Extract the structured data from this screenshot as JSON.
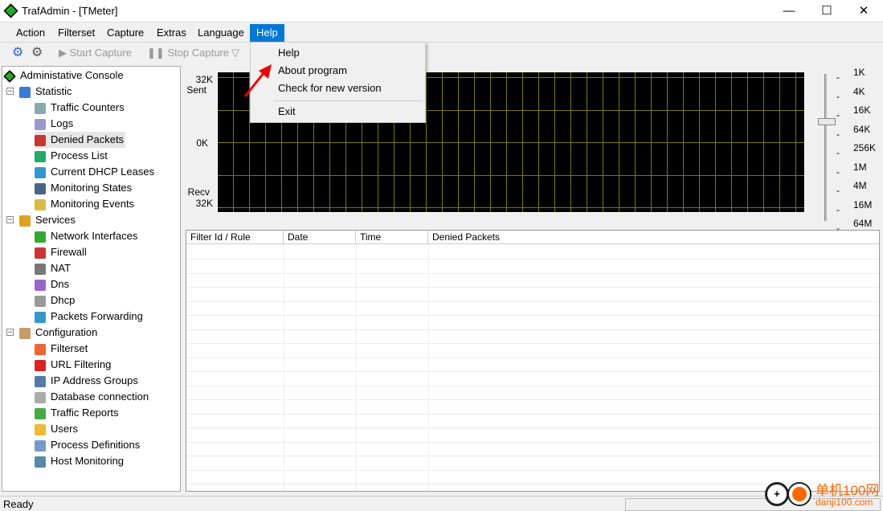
{
  "window": {
    "title": "TrafAdmin - [TMeter]",
    "minimize": "—",
    "maximize": "☐",
    "close": "✕"
  },
  "menu": [
    "Action",
    "Filterset",
    "Capture",
    "Extras",
    "Language",
    "Help"
  ],
  "toolbar": {
    "start_capture": "Start Capture",
    "stop_capture": "Stop Capture"
  },
  "help_menu": {
    "items": [
      "Help",
      "About program",
      "Check for new version"
    ],
    "exit": "Exit"
  },
  "tree": {
    "root": "Administative Console",
    "groups": [
      {
        "label": "Statistic",
        "color": "#3a7bd5",
        "items": [
          {
            "label": "Traffic Counters",
            "color": "#8aa"
          },
          {
            "label": "Logs",
            "color": "#99c"
          },
          {
            "label": "Denied Packets",
            "color": "#c33"
          },
          {
            "label": "Process List",
            "color": "#2a6"
          },
          {
            "label": "Current DHCP Leases",
            "color": "#39c"
          },
          {
            "label": "Monitoring States",
            "color": "#468"
          },
          {
            "label": "Monitoring Events",
            "color": "#db4"
          }
        ]
      },
      {
        "label": "Services",
        "color": "#e0a020",
        "items": [
          {
            "label": "Network Interfaces",
            "color": "#3a3"
          },
          {
            "label": "Firewall",
            "color": "#c33"
          },
          {
            "label": "NAT",
            "color": "#777"
          },
          {
            "label": "Dns",
            "color": "#96c"
          },
          {
            "label": "Dhcp",
            "color": "#999"
          },
          {
            "label": "Packets Forwarding",
            "color": "#39c"
          }
        ]
      },
      {
        "label": "Configuration",
        "color": "#c96",
        "items": [
          {
            "label": "Filterset",
            "color": "#e63"
          },
          {
            "label": "URL Filtering",
            "color": "#d22"
          },
          {
            "label": "IP Address Groups",
            "color": "#57a"
          },
          {
            "label": "Database connection",
            "color": "#aaa"
          },
          {
            "label": "Traffic Reports",
            "color": "#4a4"
          },
          {
            "label": "Users",
            "color": "#eb3"
          },
          {
            "label": "Process Definitions",
            "color": "#79c"
          },
          {
            "label": "Host Monitoring",
            "color": "#58a"
          }
        ]
      }
    ]
  },
  "graph": {
    "top_value": "32K",
    "top_label": "Sent",
    "mid_value": "0K",
    "bottom_label": "Recv",
    "bottom_value": "32K",
    "grid_color": "#7a7a00",
    "scale": [
      "1K",
      "4K",
      "16K",
      "64K",
      "256K",
      "1M",
      "4M",
      "16M",
      "64M"
    ],
    "selected_scale": "64K"
  },
  "table": {
    "columns": [
      "Filter Id / Rule",
      "Date",
      "Time",
      "Denied Packets"
    ],
    "rows": []
  },
  "status": {
    "text": "Ready"
  },
  "watermark": {
    "text": "单机100网",
    "url": "danji100.com"
  }
}
